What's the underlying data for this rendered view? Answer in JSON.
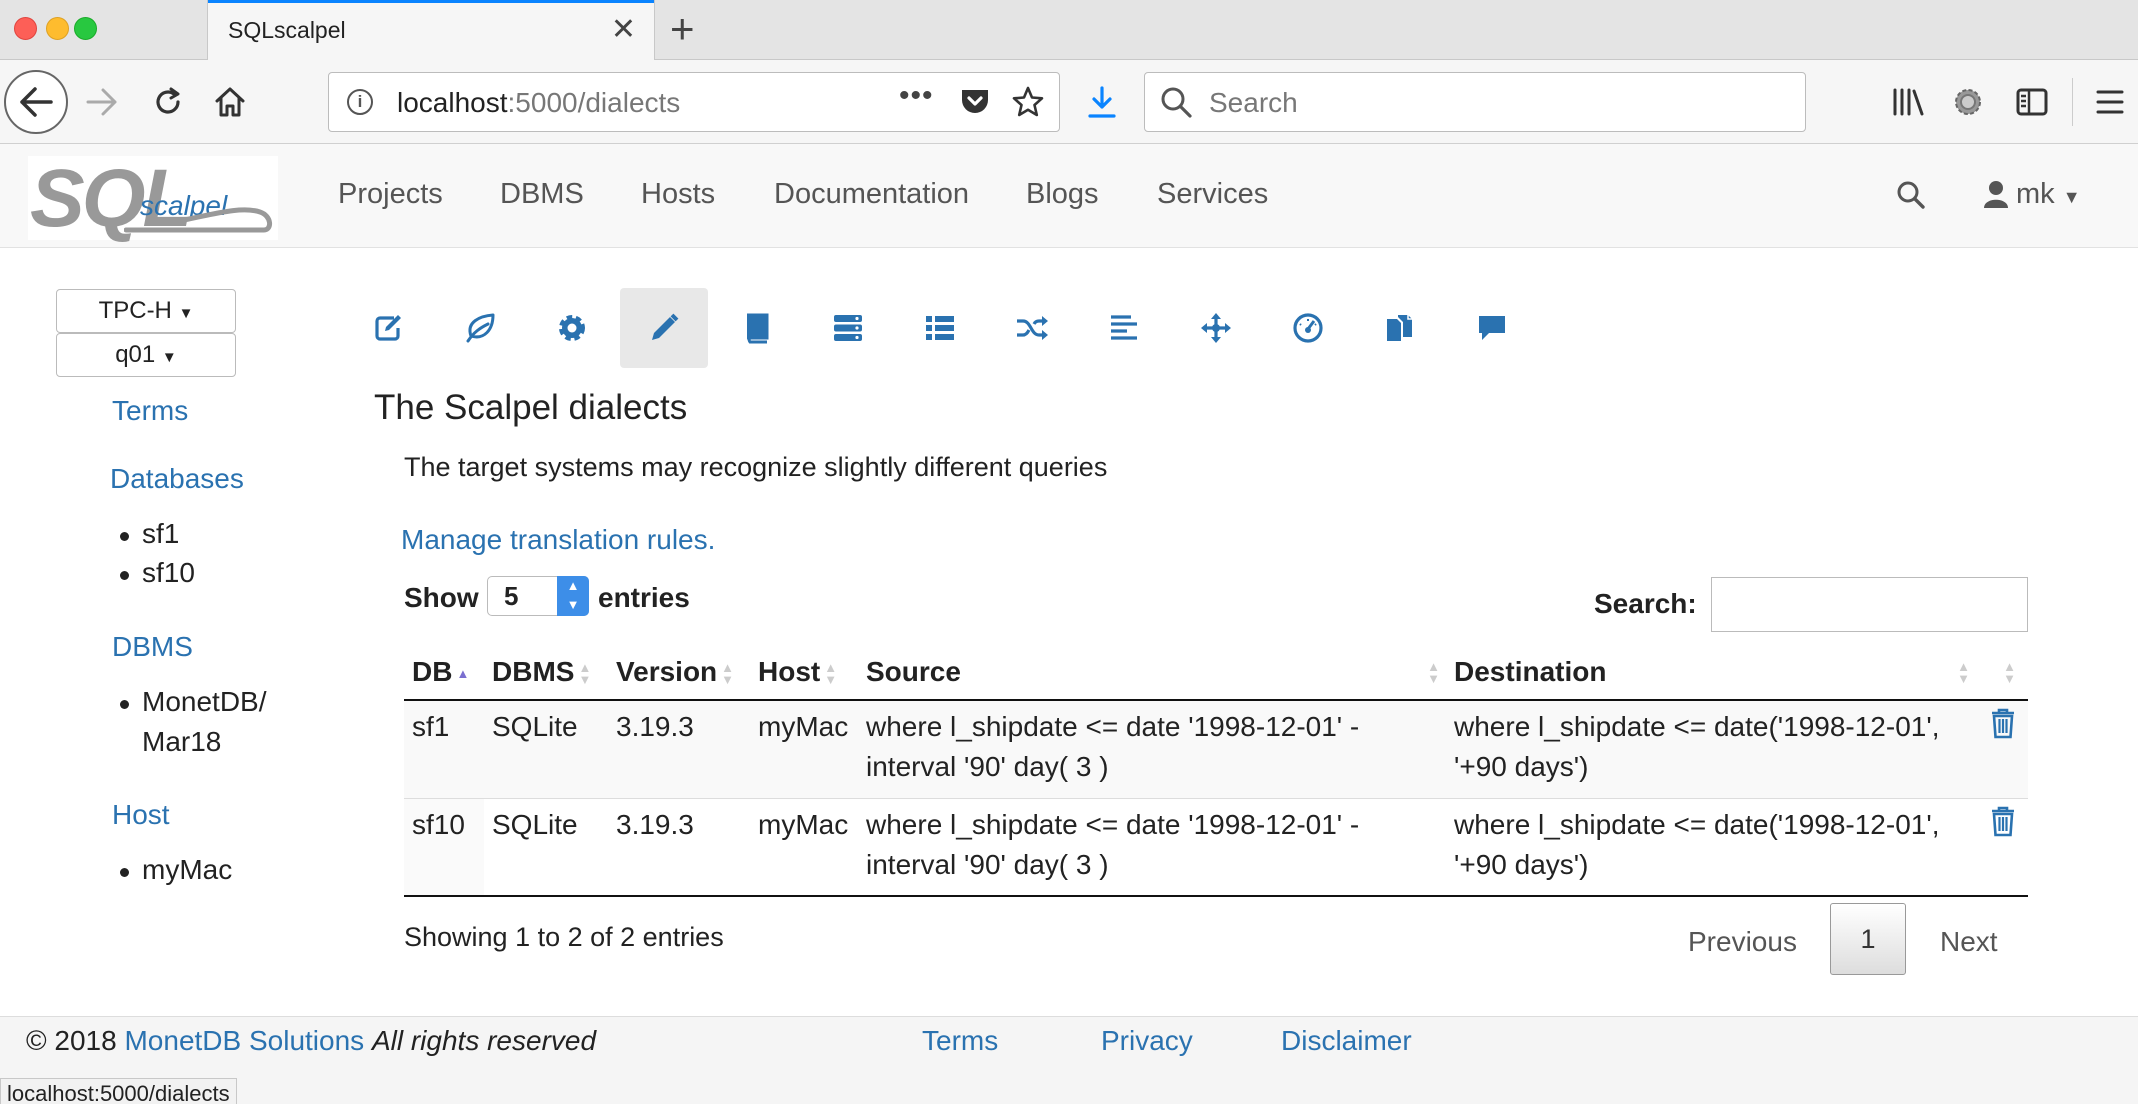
{
  "browser": {
    "tab_title": "SQLscalpel",
    "url_host": "localhost",
    "url_rest": ":5000/dialects",
    "search_placeholder": "Search",
    "status_url": "localhost:5000/dialects"
  },
  "site": {
    "logo_sql": "SQL",
    "logo_scalpel": "scalpel",
    "menu": [
      "Projects",
      "DBMS",
      "Hosts",
      "Documentation",
      "Blogs",
      "Services"
    ],
    "user": "mk"
  },
  "sidebar": {
    "project": "TPC-H",
    "query": "q01",
    "terms": "Terms",
    "databases_title": "Databases",
    "databases": [
      "sf1",
      "sf10"
    ],
    "dbms_title": "DBMS",
    "dbms": [
      "MonetDB/",
      "Mar18"
    ],
    "host_title": "Host",
    "hosts": [
      "myMac"
    ]
  },
  "toolbar": [
    "edit-icon",
    "leaf-icon",
    "gear-icon",
    "pencil-icon",
    "book-icon",
    "server-icon",
    "list-icon",
    "shuffle-icon",
    "align-left-icon",
    "move-icon",
    "dashboard-icon",
    "copy-icon",
    "comment-icon"
  ],
  "main": {
    "heading": "The Scalpel dialects",
    "subtitle": "The target systems may recognize slightly different queries",
    "manage_link": "Manage translation rules.",
    "show_label": "Show",
    "page_length": "5",
    "entries_label": "entries",
    "search_label": "Search:",
    "columns": [
      "DB",
      "DBMS",
      "Version",
      "Host",
      "Source",
      "Destination"
    ],
    "rows": [
      {
        "db": "sf1",
        "dbms": "SQLite",
        "version": "3.19.3",
        "host": "myMac",
        "source_1": "where l_shipdate <= date '1998-12-01' -",
        "source_2": "interval '90' day( 3 )",
        "dest_1": "where l_shipdate <= date('1998-12-01',",
        "dest_2": "'+90 days')"
      },
      {
        "db": "sf10",
        "dbms": "SQLite",
        "version": "3.19.3",
        "host": "myMac",
        "source_1": "where l_shipdate <= date '1998-12-01' -",
        "source_2": "interval '90' day( 3 )",
        "dest_1": "where l_shipdate <= date('1998-12-01',",
        "dest_2": "'+90 days')"
      }
    ],
    "info": "Showing 1 to 2 of 2 entries",
    "prev": "Previous",
    "page": "1",
    "next": "Next"
  },
  "footer": {
    "copy": "© 2018",
    "company": "MonetDB Solutions",
    "rights": "All rights reserved",
    "terms": "Terms",
    "privacy": "Privacy",
    "disclaimer": "Disclaimer"
  },
  "colors": {
    "accent": "#2a72b0",
    "tab_accent": "#0a84ff",
    "sort_active": "#7a6fd0"
  }
}
